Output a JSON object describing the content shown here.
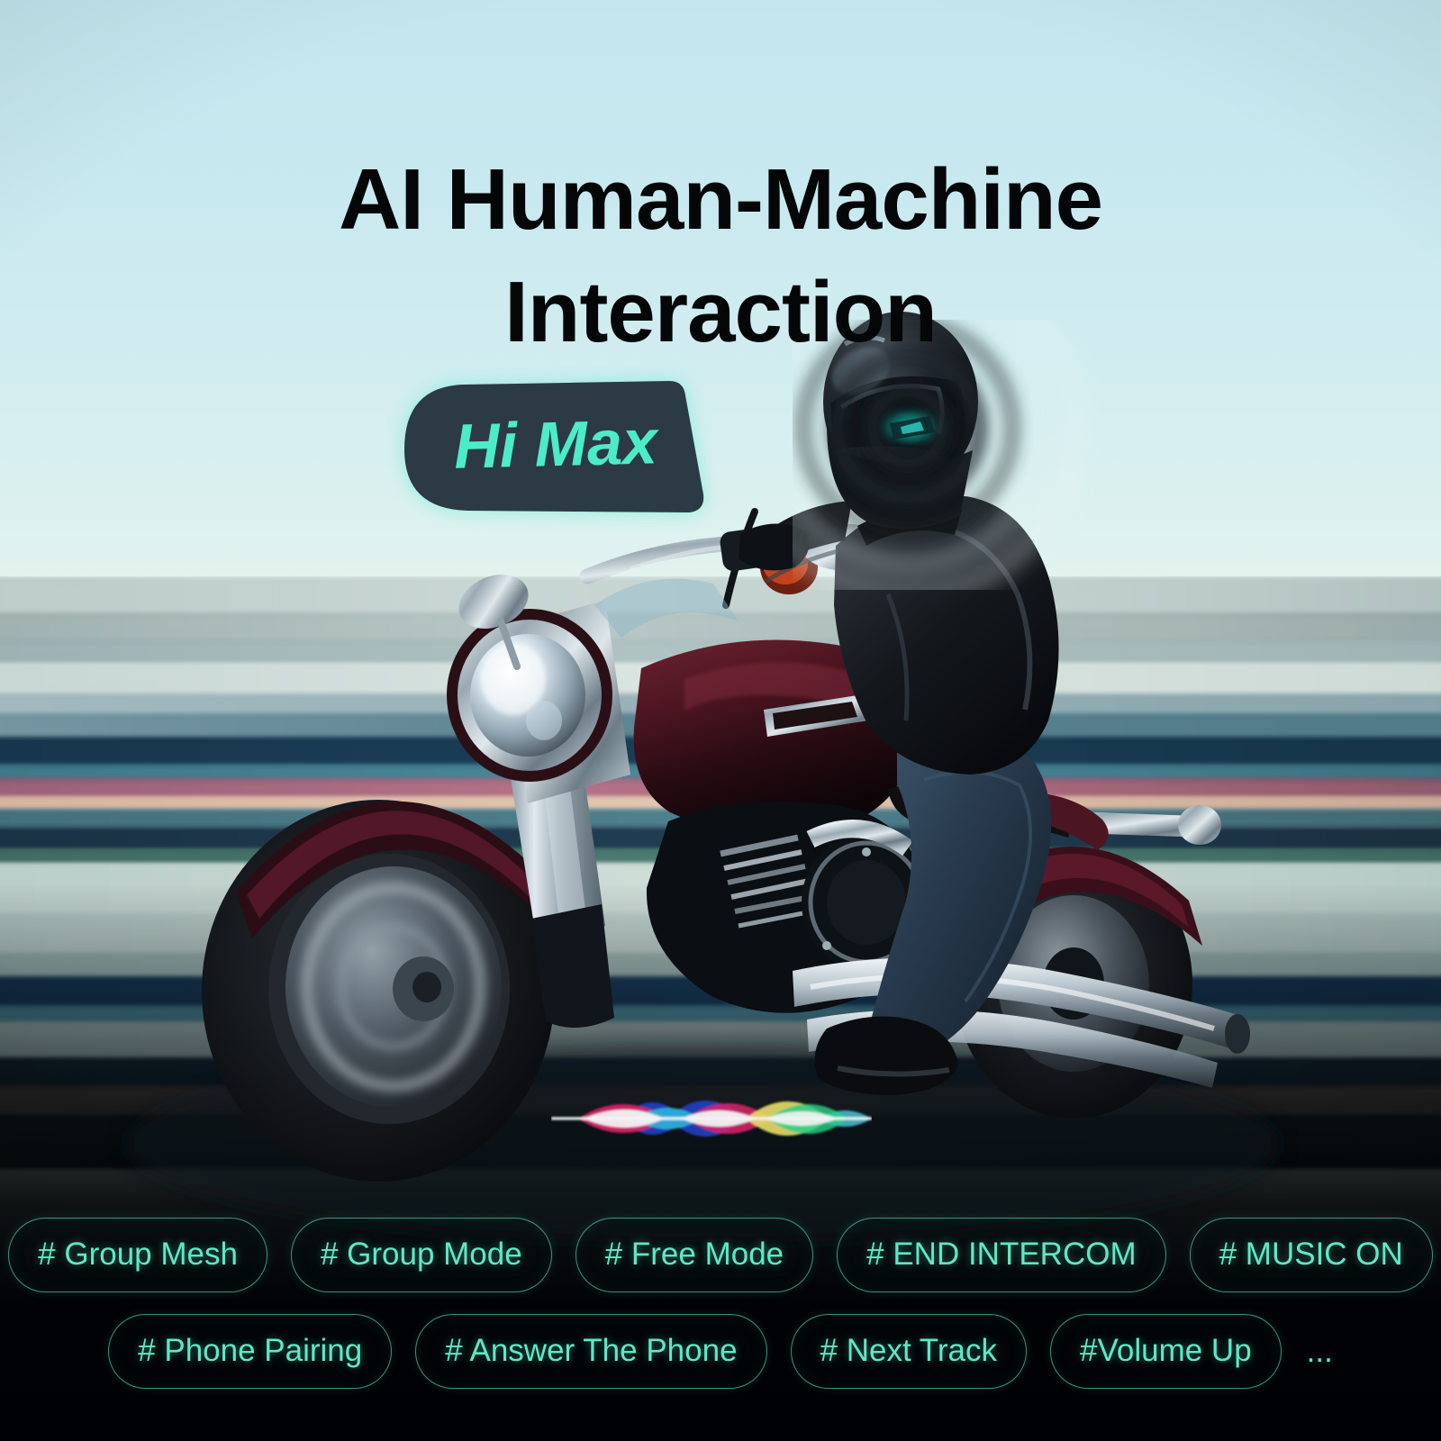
{
  "poster": {
    "title": "AI Human-Machine\nInteraction",
    "title_line1": "AI Human-Machine",
    "title_line2": "Interaction",
    "voice_badge": "Hi Max",
    "background_top_color": "#c3e6ee",
    "accent_color": "#5fe8c5",
    "badge_bg_color": "#2b3a44",
    "badge_text_color": "#4cecc9"
  },
  "scene": {
    "subject": "motorcycle-rider",
    "helmet_waves_icon": "sound-waves-icon",
    "assistant_waveform_icon": "siri-waveform-icon",
    "bike_tank_color": "#4a1420",
    "jacket_color": "#121418",
    "jeans_color": "#27394c"
  },
  "tags": {
    "row1": [
      {
        "label": "# Group Mesh"
      },
      {
        "label": "# Group Mode"
      },
      {
        "label": "# Free Mode"
      },
      {
        "label": "# END INTERCOM"
      },
      {
        "label": "# MUSIC ON"
      }
    ],
    "row2": [
      {
        "label": "# Phone Pairing"
      },
      {
        "label": "# Answer The Phone"
      },
      {
        "label": "# Next Track"
      },
      {
        "label": "#Volume Up"
      }
    ],
    "more_indicator": "..."
  }
}
